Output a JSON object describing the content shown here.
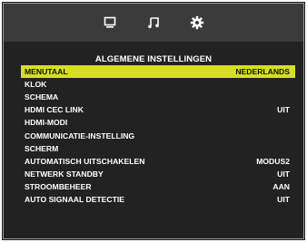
{
  "tabs": [
    {
      "icon": "monitor-icon",
      "selected": false
    },
    {
      "icon": "music-note-icon",
      "selected": false
    },
    {
      "icon": "gear-icon",
      "selected": true
    }
  ],
  "title": "ALGEMENE INSTELLINGEN",
  "colors": {
    "highlight": "#d7de1e",
    "background": "#222222",
    "topbar": "#3b3b3b"
  },
  "menu": [
    {
      "label": "MENUTAAL",
      "value": "NEDERLANDS",
      "selected": true
    },
    {
      "label": "KLOK",
      "value": ""
    },
    {
      "label": "SCHEMA",
      "value": ""
    },
    {
      "label": "HDMI CEC LINK",
      "value": "UIT"
    },
    {
      "label": "HDMI-MODI",
      "value": ""
    },
    {
      "label": "COMMUNICATIE-INSTELLING",
      "value": ""
    },
    {
      "label": "SCHERM",
      "value": ""
    },
    {
      "label": "AUTOMATISCH UITSCHAKELEN",
      "value": "MODUS2"
    },
    {
      "label": "NETWERK STANDBY",
      "value": "UIT"
    },
    {
      "label": "STROOMBEHEER",
      "value": "AAN"
    },
    {
      "label": "AUTO SIGNAAL DETECTIE",
      "value": "UIT"
    }
  ]
}
